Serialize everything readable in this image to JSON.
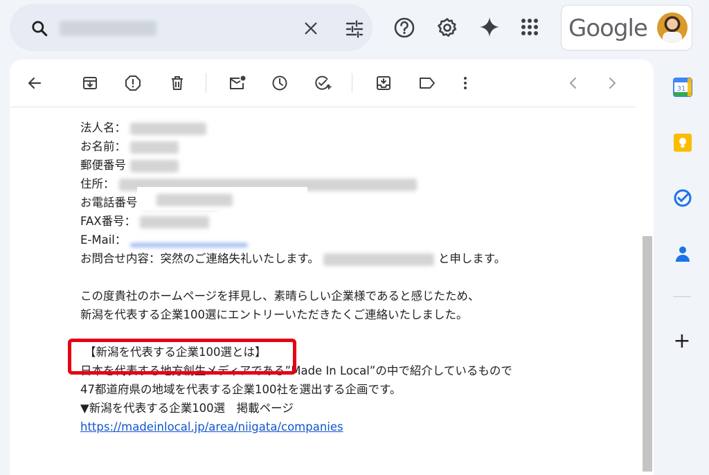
{
  "search": {
    "query": "████████"
  },
  "top_icons": [
    "help-icon",
    "settings-icon",
    "gemini-icon",
    "apps-icon"
  ],
  "account": {
    "brand": "Google"
  },
  "toolbar": {
    "icons": [
      "back-icon",
      "archive-icon",
      "report-spam-icon",
      "delete-icon",
      "mark-unread-icon",
      "snooze-icon",
      "add-task-icon",
      "move-to-icon",
      "label-icon",
      "more-icon",
      "older-icon",
      "newer-icon"
    ]
  },
  "email": {
    "lines": {
      "corp": "法人名：",
      "name": "お名前：",
      "zip": "郵便番号",
      "addr": "住所：",
      "tel": "お電話番号",
      "fax": "FAX番号：",
      "mail": "E-Mail：",
      "inquiry_a": "お問合せ内容：突然のご連絡失礼いたします。",
      "inquiry_b": "と申します。",
      "p1": "この度貴社のホームページを拝見し、素晴らしい企業様であると感じたため、",
      "p2": "新潟を代表する企業100選にエントリーいただきたくご連絡いたしました。",
      "heading": "【新潟を代表する企業100選とは】",
      "p3": "日本を代表する地方創生メディアである”Made In Local”の中で紹介しているもので",
      "p4": "47都道府県の地域を代表する企業100社を選出する企画です。",
      "p5": "▼新潟を代表する企業100選　掲載ページ",
      "url": "https://madeinlocal.jp/area/niigata/companies"
    }
  },
  "rail": {
    "calendar_day": "31",
    "add_label": "+"
  },
  "colors": {
    "highlight": "#e60012",
    "link": "#1a0dab",
    "accent": "#0b57d0"
  }
}
